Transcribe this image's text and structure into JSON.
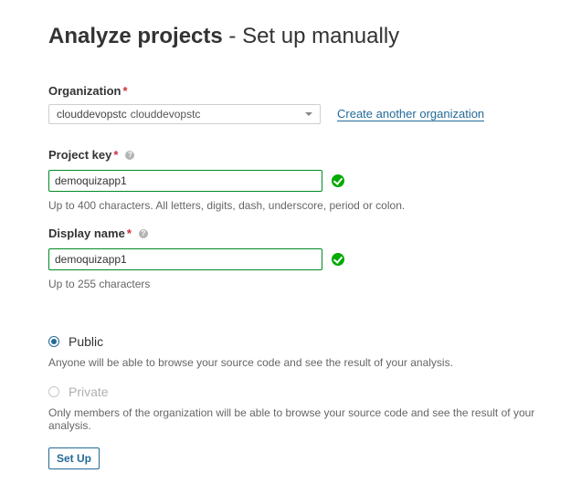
{
  "header": {
    "title_strong": "Analyze projects",
    "title_light": " - Set up manually"
  },
  "organization": {
    "label": "Organization",
    "required_mark": "*",
    "selected_key": "clouddevopstc",
    "selected_name": "clouddevopstc",
    "create_link": "Create another organization"
  },
  "project_key": {
    "label": "Project key",
    "required_mark": "*",
    "value": "demoquizapp1",
    "hint": "Up to 400 characters. All letters, digits, dash, underscore, period or colon."
  },
  "display_name": {
    "label": "Display name",
    "required_mark": "*",
    "value": "demoquizapp1",
    "hint": "Up to 255 characters"
  },
  "visibility": {
    "public_label": "Public",
    "public_desc": "Anyone will be able to browse your source code and see the result of your analysis.",
    "private_label": "Private",
    "private_desc": "Only members of the organization will be able to browse your source code and see the result of your analysis.",
    "selected": "public"
  },
  "actions": {
    "setup_label": "Set Up"
  },
  "colors": {
    "accent": "#236a97",
    "valid": "#00aa00",
    "required": "#d02f3a"
  },
  "icons": {
    "help": "question-circle-icon",
    "valid": "check-circle-icon",
    "dropdown": "caret-down-icon"
  }
}
